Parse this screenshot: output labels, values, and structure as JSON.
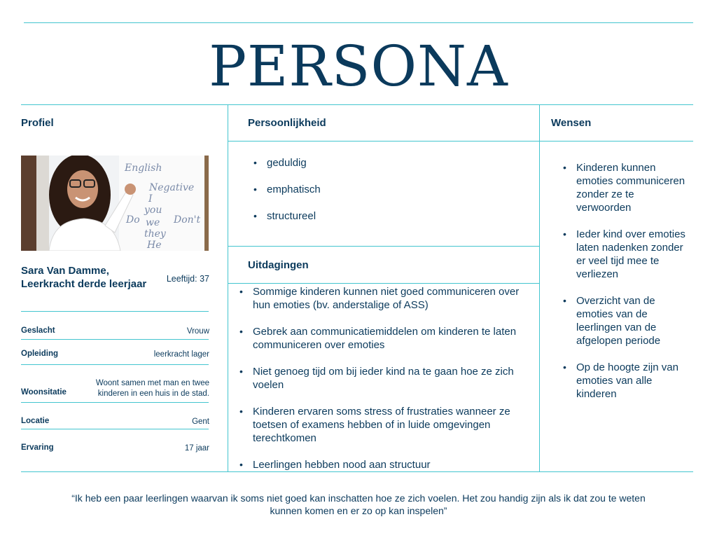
{
  "title": "PERSONA",
  "columns": {
    "profiel": "Profiel",
    "persoonlijkheid": "Persoonlijkheid",
    "wensen": "Wensen",
    "uitdagingen": "Uitdagingen"
  },
  "profile": {
    "name": "Sara Van Damme, Leerkracht derde leerjaar",
    "age": "Leeftijd: 37",
    "fields": [
      {
        "label": "Geslacht",
        "value": "Vrouw"
      },
      {
        "label": "Opleiding",
        "value": "leerkracht lager"
      },
      {
        "label": "Woonsitatie",
        "value": "Woont samen met man en twee kinderen in een huis in de stad."
      },
      {
        "label": "Locatie",
        "value": "Gent"
      },
      {
        "label": "Ervaring",
        "value": "17 jaar"
      }
    ],
    "photo_text": [
      "English",
      "Negative",
      "I",
      "you",
      "we",
      "they",
      "Do",
      "Don't",
      "He"
    ]
  },
  "personality": [
    "geduldig",
    "emphatisch",
    "structureel"
  ],
  "challenges": [
    "Sommige kinderen kunnen niet goed communiceren over hun emoties (bv. anderstalige of ASS)",
    "Gebrek aan communicatiemiddelen om kinderen te laten communiceren over emoties",
    "Niet genoeg tijd om bij ieder kind na te gaan hoe ze zich voelen",
    "Kinderen ervaren soms stress of frustraties wanneer ze toetsen of examens hebben of in luide omgevingen terechtkomen",
    "Leerlingen hebben nood aan structuur"
  ],
  "wishes": [
    "Kinderen kunnen emoties communiceren zonder ze te verwoorden",
    "Ieder kind over emoties laten nadenken zonder er veel tijd mee te verliezen",
    "Overzicht van de emoties van de leerlingen van de afgelopen periode",
    "Op de hoogte zijn van emoties van alle kinderen"
  ],
  "quote": "“Ik heb een paar leerlingen waarvan ik soms niet goed kan inschatten hoe ze zich voelen. Het zou handig zijn als ik dat zou te weten kunnen komen en er zo op kan inspelen”",
  "colors": {
    "navy": "#0b3a5c",
    "teal_line": "#43c5cf"
  }
}
